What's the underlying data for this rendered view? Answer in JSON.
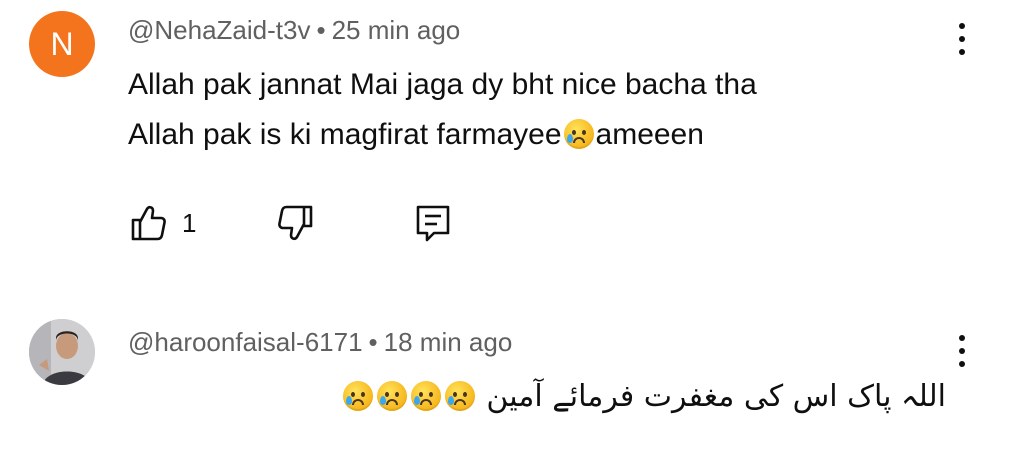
{
  "comments": [
    {
      "avatar_letter": "N",
      "avatar_color": "#f4741e",
      "handle": "@NehaZaid-t3v",
      "separator": "•",
      "time": "25 min ago",
      "text_line1": "Allah pak jannat Mai jaga dy bht nice bacha tha",
      "text_line2_a": "Allah pak is ki magfirat farmayee",
      "text_line2_b": "ameeen",
      "like_count": "1"
    },
    {
      "handle": "@haroonfaisal-6171",
      "separator": "•",
      "time": "18 min ago",
      "text": "اللہ پاک اس کی مغفرت فرمائے آمین"
    }
  ],
  "icons": {
    "like": "thumb-up-icon",
    "dislike": "thumb-down-icon",
    "reply": "reply-icon",
    "menu": "more-vert-icon",
    "emoji": "crying-face-emoji"
  }
}
